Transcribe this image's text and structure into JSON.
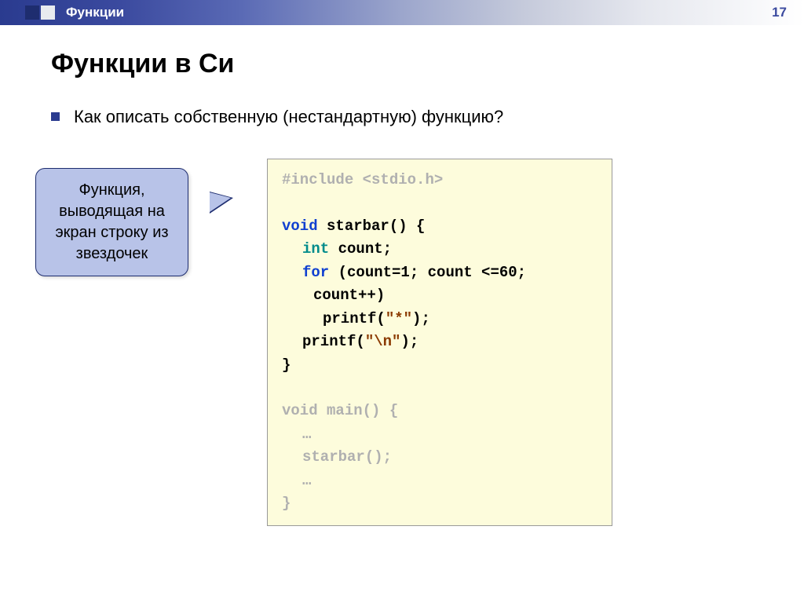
{
  "header": {
    "breadcrumb": "Функции",
    "page_number": "17"
  },
  "title": "Функции в Си",
  "bullet": {
    "text": "Как описать собственную (нестандартную) функцию?"
  },
  "callout": {
    "text": "Функция, выводящая на экран строку из звездочек"
  },
  "code": {
    "line1_a": "#include ",
    "line1_b": "<stdio.h>",
    "line3_a": "void",
    "line3_b": " starbar() {",
    "line4_a": "int",
    "line4_b": " count;",
    "line5_a": "for",
    "line5_b": " (count=1; count <=60;",
    "line6": "count++)",
    "line7_a": "printf(",
    "line7_b": "\"*\"",
    "line7_c": ");",
    "line8_a": "printf(",
    "line8_b": "\"\\n\"",
    "line8_c": ");",
    "line9": "}",
    "line11": "void main() {",
    "line12": "…",
    "line13": "starbar();",
    "line14": "…",
    "line15": "}"
  }
}
